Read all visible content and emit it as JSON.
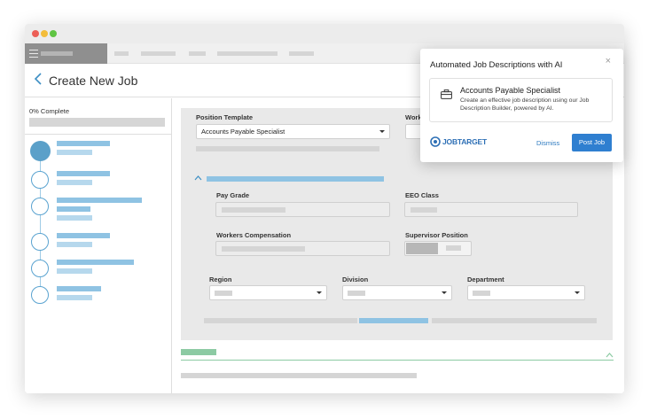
{
  "header": {
    "title": "Create New Job"
  },
  "sidebar": {
    "progress_text": "0% Complete",
    "progress": 0
  },
  "form": {
    "position_template_label": "Position Template",
    "position_template_value": "Accounts Payable Specialist",
    "workers_label_partial": "Work",
    "pay_grade_label": "Pay Grade",
    "eeo_class_label": "EEO Class",
    "workers_comp_label": "Workers Compensation",
    "supervisor_label": "Supervisor Position",
    "region_label": "Region",
    "division_label": "Division",
    "department_label": "Department"
  },
  "modal": {
    "title": "Automated Job Descriptions with AI",
    "close": "×",
    "card_title": "Accounts Payable Specialist",
    "card_desc": "Create an effective job description using our Job Description Builder, powered by AI.",
    "brand": "JOBTARGET",
    "dismiss": "Dismiss",
    "post": "Post Job"
  },
  "icons": {
    "back": "chevron-left-icon",
    "menu": "hamburger-icon",
    "briefcase": "briefcase-icon",
    "close": "close-icon"
  },
  "colors": {
    "accent": "#3d8fc4",
    "button": "#2f7fd0",
    "complete": "#8ccaa3"
  }
}
